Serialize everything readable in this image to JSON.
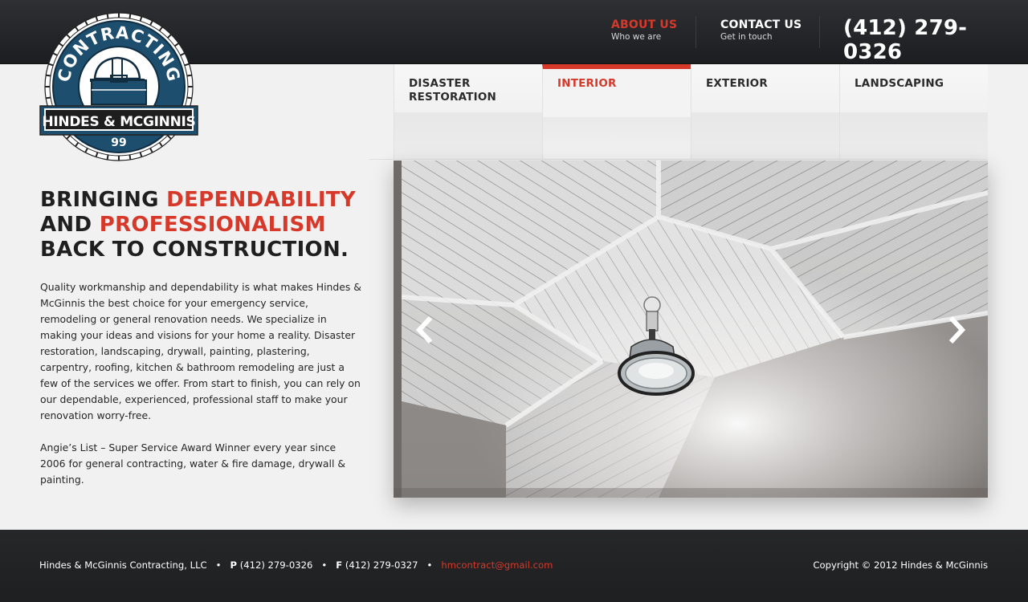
{
  "header": {
    "nav": [
      {
        "title": "ABOUT US",
        "sub": "Who we are",
        "active": true
      },
      {
        "title": "CONTACT US",
        "sub": "Get in touch",
        "active": false
      }
    ],
    "phone": "(412) 279-0326"
  },
  "logo": {
    "ring_text": "CONTRACTING",
    "banner_text": "HINDES & MCGINNIS",
    "number": "99"
  },
  "tabs": [
    {
      "label": "DISASTER RESTORATION",
      "active": false
    },
    {
      "label": "INTERIOR",
      "active": true
    },
    {
      "label": "EXTERIOR",
      "active": false
    },
    {
      "label": "LANDSCAPING",
      "active": false
    }
  ],
  "hero": {
    "headline_1": "BRINGING ",
    "headline_2": "DEPENDABILITY",
    "headline_3": "AND ",
    "headline_4": "PROFESSIONALISM",
    "headline_5": " BACK TO CONSTRUCTION.",
    "paragraph_1": "Quality workmanship and dependability is what makes Hindes & McGinnis the best choice for your emergency service, remodeling or general renovation needs.  We specialize in making your ideas and visions for your home a reality.  Disaster restoration, landscaping, drywall, painting, plastering, carpentry, roofing, kitchen & bathroom remodeling are just a few of the services we offer.  From start to finish, you can rely on our dependable, experienced, professional staff to make your renovation worry-free.",
    "paragraph_2": "Angie’s List – Super Service Award Winner every year since 2006 for general contracting, water & fire damage, drywall & painting."
  },
  "slider": {
    "prev_icon": "chevron-left-icon",
    "next_icon": "chevron-right-icon"
  },
  "footer": {
    "company": "Hindes & McGinnis Contracting, LLC",
    "phone_label": "P",
    "phone": "(412) 279-0326",
    "fax_label": "F",
    "fax": "(412) 279-0327",
    "email": "hmcontract@gmail.com",
    "copyright": "Copyright © 2012 Hindes & McGinnis"
  },
  "colors": {
    "accent": "#d6392a",
    "header_bg": "#232427",
    "logo_blue": "#1d4e6e"
  }
}
